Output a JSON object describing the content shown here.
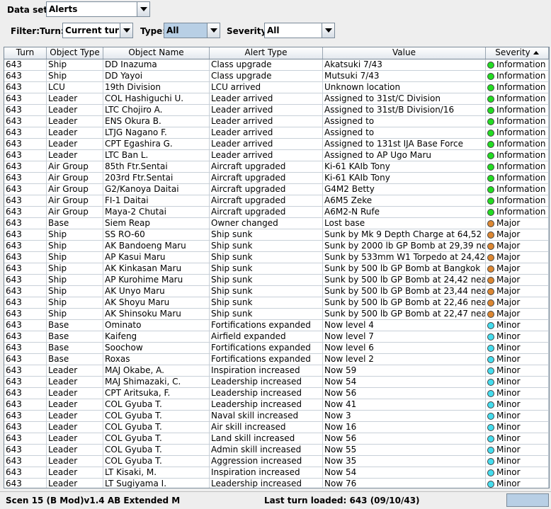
{
  "dataset": {
    "label": "Data set:",
    "value": "Alerts"
  },
  "filter": {
    "label": "Filter:",
    "turn_label": "Turn:",
    "turn_value": "Current turn",
    "type_label": "Type:",
    "type_value": "All",
    "severity_label": "Severity:",
    "severity_value": "All"
  },
  "table": {
    "columns": [
      "Turn",
      "Object Type",
      "Object Name",
      "Alert Type",
      "Value",
      "Severity"
    ],
    "rows": [
      [
        "643",
        "Ship",
        "DD Inazuma",
        "Class upgrade",
        "Akatsuki 7/43",
        "Information"
      ],
      [
        "643",
        "Ship",
        "DD Yayoi",
        "Class upgrade",
        "Mutsuki 7/43",
        "Information"
      ],
      [
        "643",
        "LCU",
        "19th Division",
        "LCU arrived",
        "Unknown location",
        "Information"
      ],
      [
        "643",
        "Leader",
        "COL Hashiguchi U.",
        "Leader arrived",
        "Assigned to 31st/C Division",
        "Information"
      ],
      [
        "643",
        "Leader",
        "LTC Chojiro A.",
        "Leader arrived",
        "Assigned to 31st/B Division/16",
        "Information"
      ],
      [
        "643",
        "Leader",
        "ENS Okura B.",
        "Leader arrived",
        "Assigned to",
        "Information"
      ],
      [
        "643",
        "Leader",
        "LTJG Nagano F.",
        "Leader arrived",
        "Assigned to",
        "Information"
      ],
      [
        "643",
        "Leader",
        "CPT Egashira G.",
        "Leader arrived",
        "Assigned to 131st IJA Base Force",
        "Information"
      ],
      [
        "643",
        "Leader",
        "LTC Ban L.",
        "Leader arrived",
        "Assigned to AP Ugo Maru",
        "Information"
      ],
      [
        "643",
        "Air Group",
        "85th Ftr.Sentai",
        "Aircraft upgraded",
        "Ki-61 KAIb Tony",
        "Information"
      ],
      [
        "643",
        "Air Group",
        "203rd Ftr.Sentai",
        "Aircraft upgraded",
        "Ki-61 KAIb Tony",
        "Information"
      ],
      [
        "643",
        "Air Group",
        "G2/Kanoya Daitai",
        "Aircraft upgraded",
        "G4M2 Betty",
        "Information"
      ],
      [
        "643",
        "Air Group",
        "FI-1 Daitai",
        "Aircraft upgraded",
        "A6M5 Zeke",
        "Information"
      ],
      [
        "643",
        "Air Group",
        "Maya-2 Chutai",
        "Aircraft upgraded",
        "A6M2-N Rufe",
        "Information"
      ],
      [
        "643",
        "Base",
        "Siem Reap",
        "Owner changed",
        "Lost base",
        "Major"
      ],
      [
        "643",
        "Ship",
        "SS RO-60",
        "Ship sunk",
        "Sunk by Mk 9 Depth Charge at 64,52 ne...",
        "Major"
      ],
      [
        "643",
        "Ship",
        "AK Bandoeng Maru",
        "Ship sunk",
        "Sunk by 2000 lb GP Bomb at 29,39 near...",
        "Major"
      ],
      [
        "643",
        "Ship",
        "AP Kasui Maru",
        "Ship sunk",
        "Sunk by 533mm W1 Torpedo at 24,42 n...",
        "Major"
      ],
      [
        "643",
        "Ship",
        "AK Kinkasan Maru",
        "Ship sunk",
        "Sunk by 500 lb GP Bomb at Bangkok",
        "Major"
      ],
      [
        "643",
        "Ship",
        "AP Kurohime Maru",
        "Ship sunk",
        "Sunk by 500 lb GP Bomb at 24,42 near ...",
        "Major"
      ],
      [
        "643",
        "Ship",
        "AK Unyo Maru",
        "Ship sunk",
        "Sunk by 500 lb GP Bomb at 23,44 near ...",
        "Major"
      ],
      [
        "643",
        "Ship",
        "AK Shoyu Maru",
        "Ship sunk",
        "Sunk by 500 lb GP Bomb at 22,46 near ...",
        "Major"
      ],
      [
        "643",
        "Ship",
        "AK Shinsoku Maru",
        "Ship sunk",
        "Sunk by 500 lb GP Bomb at 22,47 near ...",
        "Major"
      ],
      [
        "643",
        "Base",
        "Ominato",
        "Fortifications expanded",
        "Now level 4",
        "Minor"
      ],
      [
        "643",
        "Base",
        "Kaifeng",
        "Airfield expanded",
        "Now level 7",
        "Minor"
      ],
      [
        "643",
        "Base",
        "Soochow",
        "Fortifications expanded",
        "Now level 6",
        "Minor"
      ],
      [
        "643",
        "Base",
        "Roxas",
        "Fortifications expanded",
        "Now level 2",
        "Minor"
      ],
      [
        "643",
        "Leader",
        "MAJ Okabe, A.",
        "Inspiration increased",
        "Now 59",
        "Minor"
      ],
      [
        "643",
        "Leader",
        "MAJ Shimazaki, C.",
        "Leadership increased",
        "Now 54",
        "Minor"
      ],
      [
        "643",
        "Leader",
        "CPT Aritsuka, F.",
        "Leadership increased",
        "Now 56",
        "Minor"
      ],
      [
        "643",
        "Leader",
        "COL Gyuba T.",
        "Leadership increased",
        "Now 41",
        "Minor"
      ],
      [
        "643",
        "Leader",
        "COL Gyuba T.",
        "Naval skill increased",
        "Now 3",
        "Minor"
      ],
      [
        "643",
        "Leader",
        "COL Gyuba T.",
        "Air skill increased",
        "Now 16",
        "Minor"
      ],
      [
        "643",
        "Leader",
        "COL Gyuba T.",
        "Land skill increased",
        "Now 56",
        "Minor"
      ],
      [
        "643",
        "Leader",
        "COL Gyuba T.",
        "Admin skill increased",
        "Now 55",
        "Minor"
      ],
      [
        "643",
        "Leader",
        "COL Gyuba T.",
        "Aggression increased",
        "Now 35",
        "Minor"
      ],
      [
        "643",
        "Leader",
        "LT Kisaki, M.",
        "Inspiration increased",
        "Now 54",
        "Minor"
      ],
      [
        "643",
        "Leader",
        "LT Sugiyama I.",
        "Leadership increased",
        "Now 76",
        "Minor"
      ]
    ]
  },
  "severity_colors": {
    "Information": "#22dd22",
    "Major": "#dd8833",
    "Minor": "#44ddee"
  },
  "status": {
    "scenario": "Scen 15 (B Mod)v1.4 AB Extended M",
    "last_turn": "Last turn loaded: 643 (09/10/43)"
  }
}
